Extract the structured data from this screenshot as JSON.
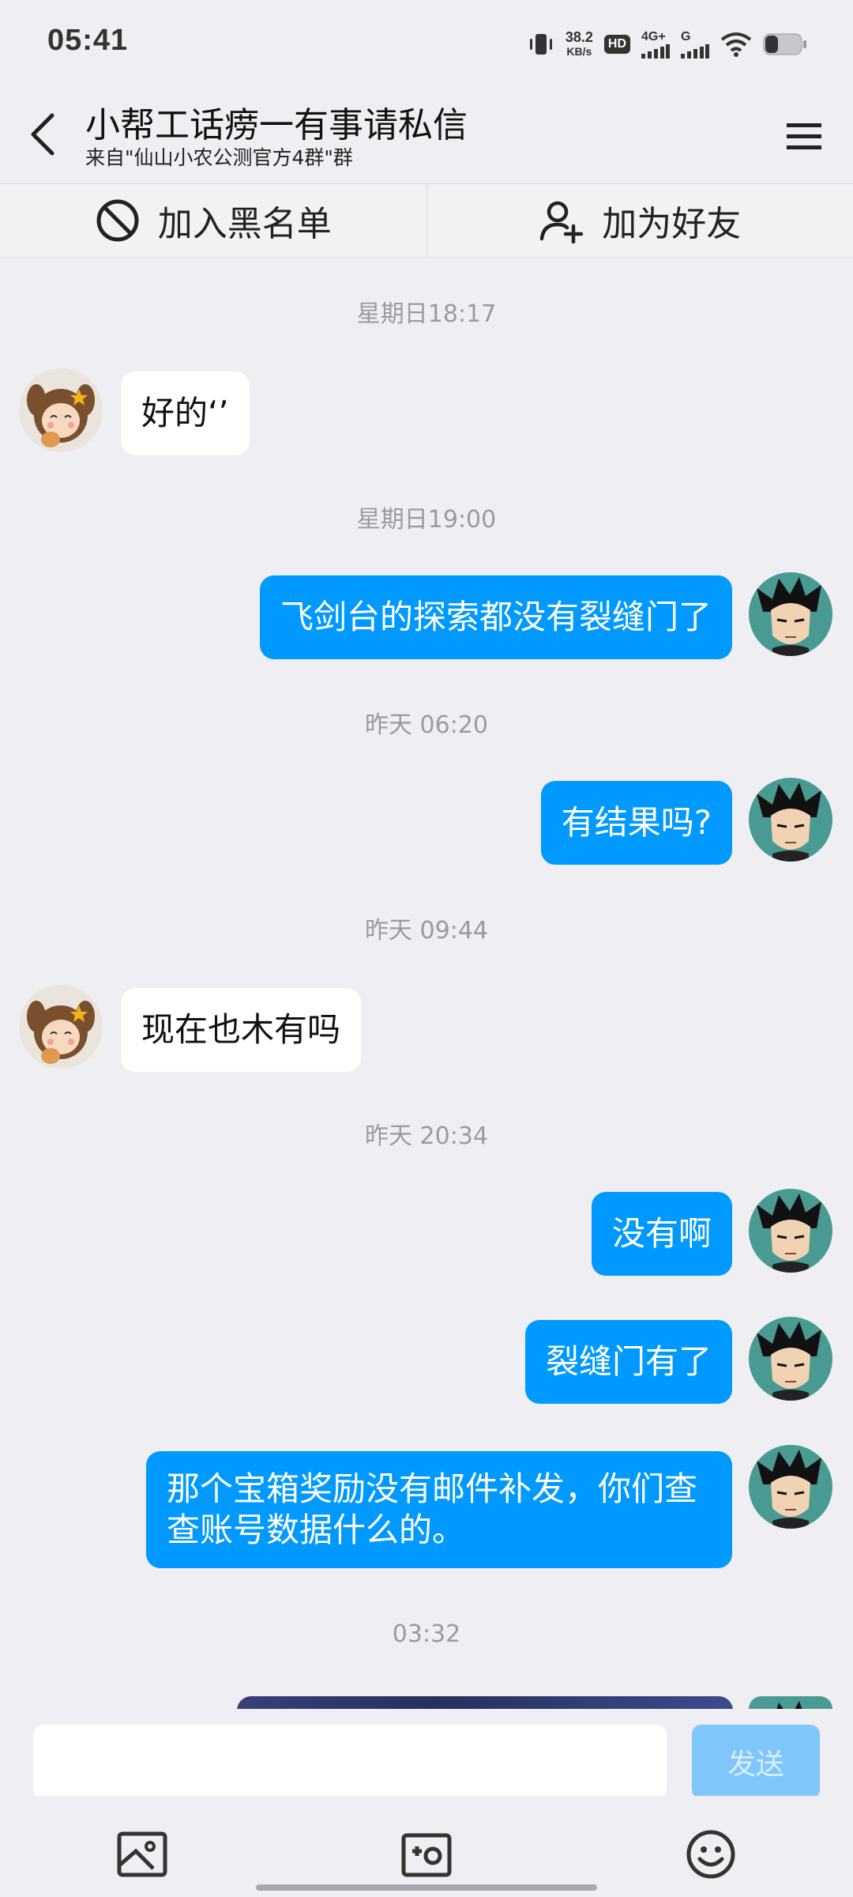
{
  "status_bar": {
    "time": "05:41",
    "net_speed_value": "38.2",
    "net_speed_unit": "KB/s",
    "hd_badge": "HD",
    "network_label": "4G+",
    "network2_label": "G",
    "icons": [
      "vibrate-icon",
      "hd-icon",
      "signal-4g-icon",
      "signal-g-icon",
      "wifi-icon",
      "battery-icon"
    ]
  },
  "header": {
    "title": "小帮工话痨一有事请私信",
    "subtitle": "来自\"仙山小农公测官方4群\"群"
  },
  "actions": {
    "blacklist_label": "加入黑名单",
    "add_friend_label": "加为好友"
  },
  "messages": [
    {
      "type": "timestamp",
      "text": "星期日18:17"
    },
    {
      "type": "incoming",
      "text": "好的‘’"
    },
    {
      "type": "timestamp",
      "text": "星期日19:00"
    },
    {
      "type": "outgoing",
      "text": "飞剑台的探索都没有裂缝门了"
    },
    {
      "type": "timestamp",
      "text": "昨天 06:20"
    },
    {
      "type": "outgoing",
      "text": "有结果吗?"
    },
    {
      "type": "timestamp",
      "text": "昨天 09:44"
    },
    {
      "type": "incoming",
      "text": "现在也木有吗"
    },
    {
      "type": "timestamp",
      "text": "昨天 20:34"
    },
    {
      "type": "outgoing",
      "text": "没有啊"
    },
    {
      "type": "outgoing",
      "text": "裂缝门有了"
    },
    {
      "type": "outgoing",
      "text": "那个宝箱奖励没有邮件补发，你们查查账号数据什么的。"
    },
    {
      "type": "timestamp",
      "text": "03:32"
    },
    {
      "type": "outgoing-image",
      "text": ""
    }
  ],
  "input": {
    "value": "",
    "placeholder": "",
    "send_label": "发送"
  },
  "toolbar": {
    "items": [
      "image-icon",
      "camera-icon",
      "emoji-icon"
    ]
  },
  "colors": {
    "background": "#eeeef3",
    "outgoing_bubble": "#0099ff",
    "incoming_bubble": "#ffffff",
    "send_button": "#7fc6fb",
    "timestamp_text": "#9a9aa0"
  }
}
